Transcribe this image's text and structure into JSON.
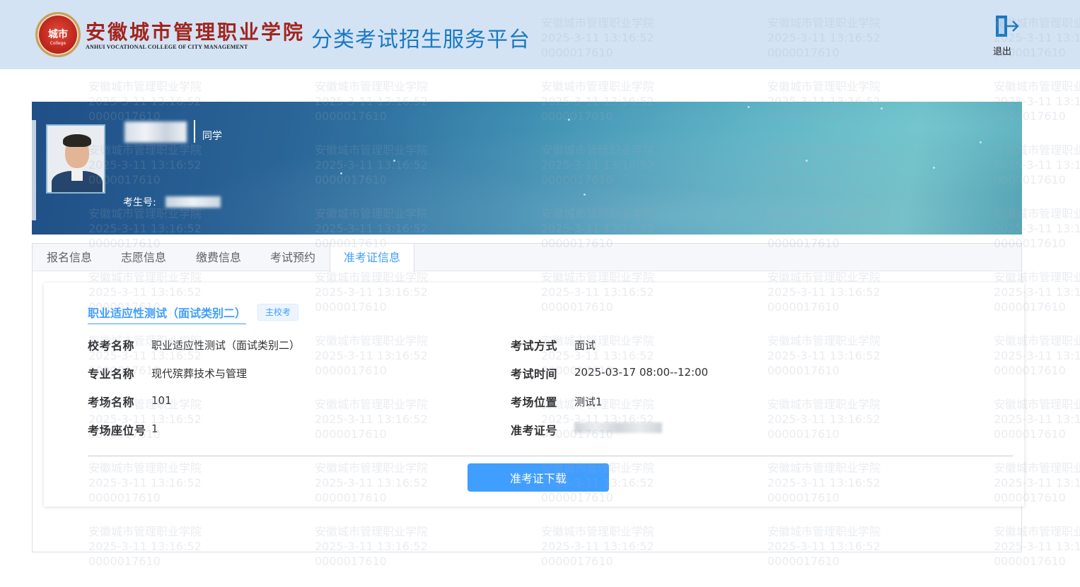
{
  "header": {
    "logo_text": "城市",
    "logo_sub": "College",
    "school_name_cn": "安徽城市管理职业学院",
    "school_name_en": "ANHUI VOCATIONAL COLLEGE OF CITY MANAGEMENT",
    "platform_title": "分类考试招生服务平台",
    "logout_label": "退出",
    "logout_icon": "logout-icon"
  },
  "watermark": {
    "line1": "安徽城市管理职业学院",
    "line2": "2025-3-11 13:16:52",
    "line3": "0000017610"
  },
  "profile": {
    "suffix": "同学",
    "exam_no_label": "考生号:"
  },
  "tabs": [
    {
      "label": "报名信息",
      "active": false
    },
    {
      "label": "志愿信息",
      "active": false
    },
    {
      "label": "缴费信息",
      "active": false
    },
    {
      "label": "考试预约",
      "active": false
    },
    {
      "label": "准考证信息",
      "active": true
    }
  ],
  "admission": {
    "title": "职业适应性测试（面试类别二）",
    "badge": "主校考",
    "fields_left": [
      {
        "label": "校考名称",
        "value": "职业适应性测试（面试类别二）"
      },
      {
        "label": "专业名称",
        "value": "现代殡葬技术与管理"
      },
      {
        "label": "考场名称",
        "value": "101"
      },
      {
        "label": "考场座位号",
        "value": "1"
      }
    ],
    "fields_right": [
      {
        "label": "考试方式",
        "value": "面试"
      },
      {
        "label": "考试时间",
        "value": "2025-03-17 08:00--12:00"
      },
      {
        "label": "考场位置",
        "value": "测试1"
      },
      {
        "label": "准考证号",
        "value": ""
      }
    ],
    "download_label": "准考证下载"
  },
  "colors": {
    "primary": "#409eff",
    "header_bg": "#d4e3f4",
    "platform_title": "#1a78c2",
    "school_red": "#a1261e"
  }
}
